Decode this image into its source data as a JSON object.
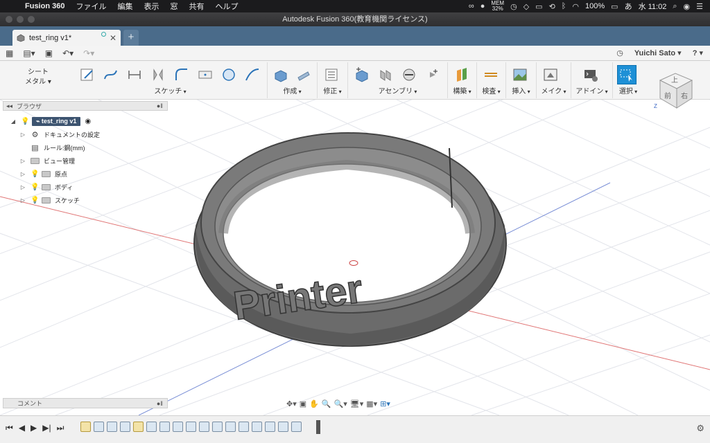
{
  "menubar": {
    "app_name": "Fusion 360",
    "items": [
      "ファイル",
      "編集",
      "表示",
      "窓",
      "共有",
      "ヘルプ"
    ],
    "mem_label": "MEM",
    "mem_value": "32%",
    "battery": "100%",
    "input_method": "あ",
    "clock": "水 11:02"
  },
  "window": {
    "title": "Autodesk Fusion 360(教育機関ライセンス)"
  },
  "doc_tab": {
    "name": "test_ring v1*",
    "new_tab_label": "+"
  },
  "account": {
    "user": "Yuichi Sato",
    "help": "?"
  },
  "ribbon": {
    "mode_line1": "シート",
    "mode_line2": "メタル",
    "groups": {
      "sketch": "スケッチ",
      "create": "作成",
      "modify": "修正",
      "assemble": "アセンブリ",
      "construct": "構築",
      "inspect": "検査",
      "insert": "挿入",
      "make": "メイク",
      "addins": "アドイン",
      "select": "選択"
    }
  },
  "browser": {
    "title": "ブラウザ",
    "root": "test_ring v1",
    "items": {
      "doc_settings": "ドキュメントの設定",
      "units": "ルール:鋼(mm)",
      "named_views": "ビュー管理",
      "origin": "原点",
      "bodies": "ボディ",
      "sketches": "スケッチ"
    }
  },
  "comments": {
    "title": "コメント"
  },
  "viewcube": {
    "top": "上",
    "front": "前",
    "right": "右",
    "axis_z": "Z"
  },
  "model": {
    "engraving": "Printer"
  },
  "colors": {
    "tab_bar": "#4a6b8a",
    "root_highlight": "#3d5470",
    "select_active": "#1e90d6",
    "ring": "#6b6b6b"
  }
}
